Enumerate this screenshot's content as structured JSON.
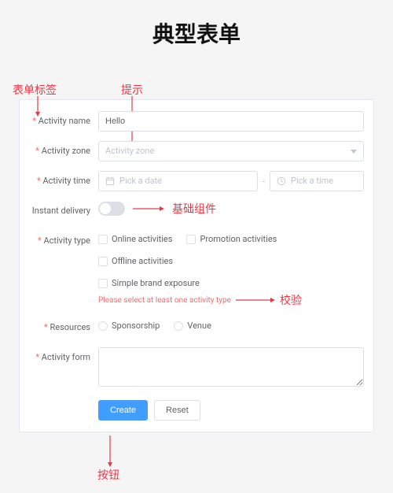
{
  "title": "典型表单",
  "annotations": {
    "formLabel": "表单标签",
    "hint": "提示",
    "basicComponent": "基础组件",
    "validation": "校验",
    "button": "按钮"
  },
  "labels": {
    "activityName": "Activity name",
    "activityZone": "Activity zone",
    "activityTime": "Activity time",
    "instantDelivery": "Instant delivery",
    "activityType": "Activity type",
    "resources": "Resources",
    "activityForm": "Activity form"
  },
  "values": {
    "activityName": "Hello"
  },
  "placeholders": {
    "activityZone": "Activity zone",
    "pickDate": "Pick a date",
    "pickTime": "Pick a time"
  },
  "options": {
    "activityType": [
      "Online activities",
      "Promotion activities",
      "Offline activities",
      "Simple brand exposure"
    ],
    "resources": [
      "Sponsorship",
      "Venue"
    ]
  },
  "errors": {
    "activityType": "Please select at least one activity type"
  },
  "buttons": {
    "create": "Create",
    "reset": "Reset"
  }
}
